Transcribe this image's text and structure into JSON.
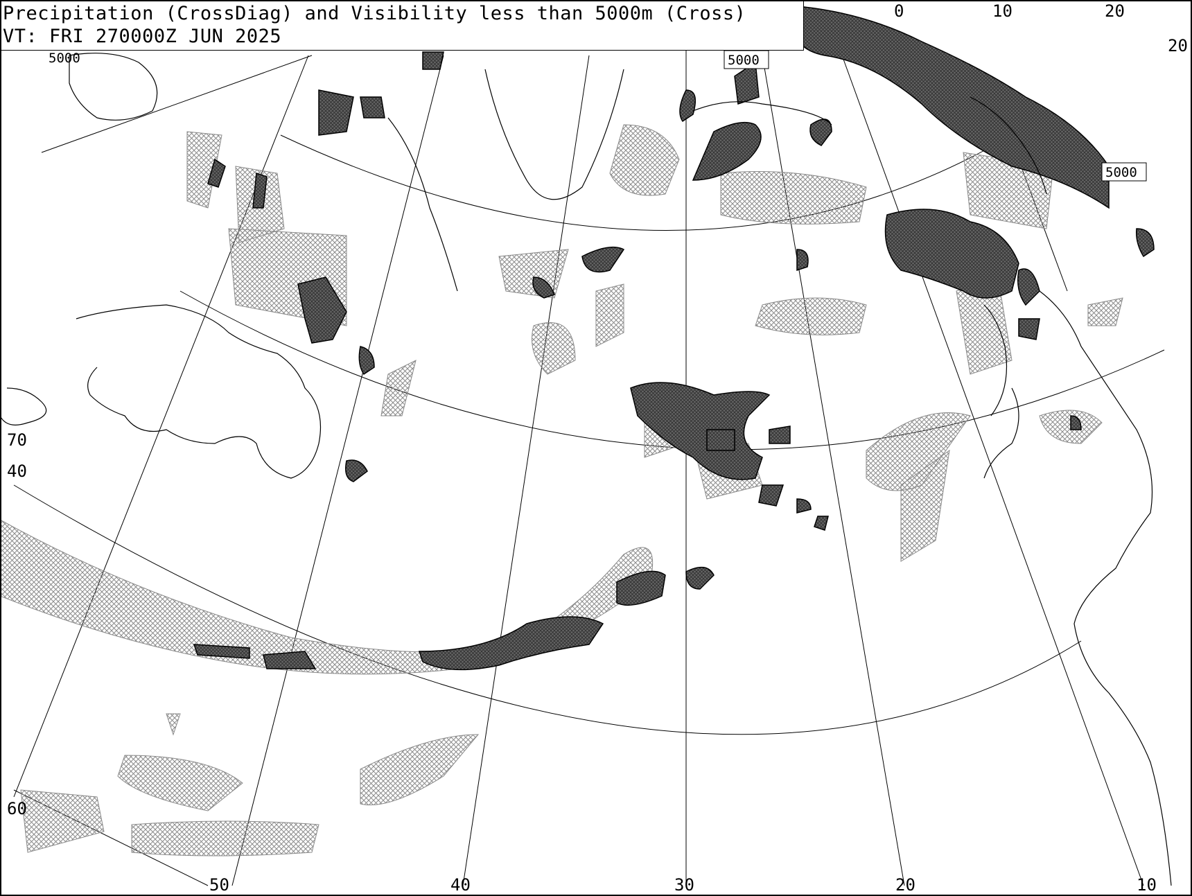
{
  "header": {
    "title": "Precipitation (CrossDiag) and Visibility less than 5000m (Cross)",
    "valid_time": "VT: FRI 270000Z JUN 2025"
  },
  "meridian_labels": [
    "50",
    "40",
    "30",
    "20",
    "10"
  ],
  "top_labels": [
    "0",
    "10",
    "20"
  ],
  "right_labels": [
    "20"
  ],
  "parallel_labels": [
    "70",
    "40",
    "60"
  ],
  "contour_labels": [
    "5000",
    "5000",
    "5000"
  ],
  "colors": {
    "background": "#ffffff",
    "line": "#000000",
    "light_hatch": "#8a8a8a",
    "dense_fill": "#555555"
  }
}
